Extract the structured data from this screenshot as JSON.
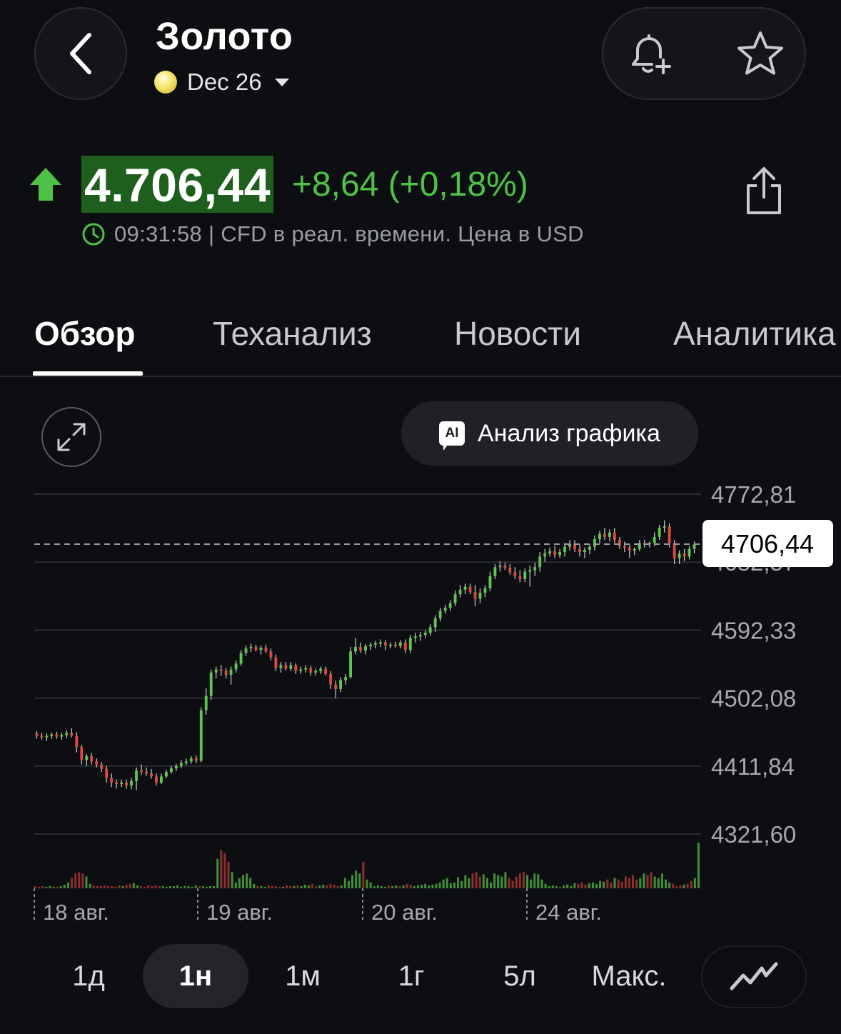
{
  "header": {
    "title": "Золото",
    "contract": "Dec 26",
    "back_icon": "chevron-left-icon",
    "alert_icon": "bell-plus-icon",
    "watchlist_icon": "star-icon",
    "share_icon": "share-icon"
  },
  "quote": {
    "price": "4.706,44",
    "change": "+8,64 (+0,18%)",
    "direction": "up",
    "meta": "09:31:58 | CFD в реал. времени. Цена в USD",
    "up_color": "#4ec246",
    "price_bg_color": "#1f5f1e"
  },
  "tabs": [
    {
      "label": "Обзор",
      "active": true
    },
    {
      "label": "Теханализ",
      "active": false
    },
    {
      "label": "Новости",
      "active": false
    },
    {
      "label": "Аналитика",
      "active": false
    }
  ],
  "chart_actions": {
    "expand_icon": "expand-icon",
    "ai_badge": "AI",
    "ai_label": "Анализ графика"
  },
  "chart_data": {
    "type": "candlestick",
    "y_ticks": [
      "4772,81",
      "4682,57",
      "4592,33",
      "4502,08",
      "4411,84",
      "4321,60"
    ],
    "y_tick_values": [
      4772.81,
      4682.57,
      4592.33,
      4502.08,
      4411.84,
      4321.6
    ],
    "ylim": [
      4321.6,
      4772.81
    ],
    "current_price_label": "4706,44",
    "current_price": 4706.44,
    "x_tick_labels": [
      "18 авг.",
      "19 авг.",
      "20 авг.",
      "24 авг."
    ],
    "grid": true,
    "up_color": "#5cc94e",
    "down_color": "#e0483f",
    "candles": [
      {
        "o": 4455,
        "h": 4458,
        "l": 4448,
        "c": 4452
      },
      {
        "o": 4452,
        "h": 4456,
        "l": 4447,
        "c": 4450
      },
      {
        "o": 4450,
        "h": 4455,
        "l": 4445,
        "c": 4452
      },
      {
        "o": 4452,
        "h": 4456,
        "l": 4448,
        "c": 4454
      },
      {
        "o": 4454,
        "h": 4457,
        "l": 4448,
        "c": 4451
      },
      {
        "o": 4451,
        "h": 4456,
        "l": 4447,
        "c": 4453
      },
      {
        "o": 4453,
        "h": 4459,
        "l": 4449,
        "c": 4456
      },
      {
        "o": 4456,
        "h": 4462,
        "l": 4450,
        "c": 4452
      },
      {
        "o": 4452,
        "h": 4457,
        "l": 4430,
        "c": 4437
      },
      {
        "o": 4437,
        "h": 4440,
        "l": 4414,
        "c": 4420
      },
      {
        "o": 4420,
        "h": 4428,
        "l": 4412,
        "c": 4425
      },
      {
        "o": 4425,
        "h": 4429,
        "l": 4414,
        "c": 4418
      },
      {
        "o": 4418,
        "h": 4422,
        "l": 4410,
        "c": 4414
      },
      {
        "o": 4414,
        "h": 4417,
        "l": 4404,
        "c": 4408
      },
      {
        "o": 4408,
        "h": 4412,
        "l": 4390,
        "c": 4396
      },
      {
        "o": 4396,
        "h": 4402,
        "l": 4384,
        "c": 4390
      },
      {
        "o": 4390,
        "h": 4394,
        "l": 4382,
        "c": 4388
      },
      {
        "o": 4388,
        "h": 4394,
        "l": 4384,
        "c": 4390
      },
      {
        "o": 4390,
        "h": 4394,
        "l": 4382,
        "c": 4386
      },
      {
        "o": 4386,
        "h": 4396,
        "l": 4381,
        "c": 4392
      },
      {
        "o": 4392,
        "h": 4410,
        "l": 4380,
        "c": 4406
      },
      {
        "o": 4406,
        "h": 4414,
        "l": 4400,
        "c": 4404
      },
      {
        "o": 4404,
        "h": 4410,
        "l": 4399,
        "c": 4402
      },
      {
        "o": 4402,
        "h": 4408,
        "l": 4395,
        "c": 4398
      },
      {
        "o": 4398,
        "h": 4402,
        "l": 4386,
        "c": 4390
      },
      {
        "o": 4390,
        "h": 4402,
        "l": 4388,
        "c": 4398
      },
      {
        "o": 4398,
        "h": 4407,
        "l": 4396,
        "c": 4404
      },
      {
        "o": 4404,
        "h": 4412,
        "l": 4402,
        "c": 4409
      },
      {
        "o": 4409,
        "h": 4415,
        "l": 4405,
        "c": 4412
      },
      {
        "o": 4412,
        "h": 4420,
        "l": 4409,
        "c": 4416
      },
      {
        "o": 4416,
        "h": 4422,
        "l": 4413,
        "c": 4418
      },
      {
        "o": 4418,
        "h": 4425,
        "l": 4415,
        "c": 4422
      },
      {
        "o": 4422,
        "h": 4426,
        "l": 4416,
        "c": 4419
      },
      {
        "o": 4419,
        "h": 4490,
        "l": 4417,
        "c": 4486
      },
      {
        "o": 4486,
        "h": 4515,
        "l": 4480,
        "c": 4505
      },
      {
        "o": 4505,
        "h": 4540,
        "l": 4500,
        "c": 4536
      },
      {
        "o": 4536,
        "h": 4544,
        "l": 4528,
        "c": 4540
      },
      {
        "o": 4540,
        "h": 4546,
        "l": 4532,
        "c": 4538
      },
      {
        "o": 4538,
        "h": 4542,
        "l": 4528,
        "c": 4533
      },
      {
        "o": 4533,
        "h": 4544,
        "l": 4520,
        "c": 4540
      },
      {
        "o": 4540,
        "h": 4552,
        "l": 4536,
        "c": 4548
      },
      {
        "o": 4548,
        "h": 4566,
        "l": 4545,
        "c": 4562
      },
      {
        "o": 4562,
        "h": 4572,
        "l": 4558,
        "c": 4568
      },
      {
        "o": 4568,
        "h": 4574,
        "l": 4563,
        "c": 4570
      },
      {
        "o": 4570,
        "h": 4573,
        "l": 4564,
        "c": 4566
      },
      {
        "o": 4566,
        "h": 4572,
        "l": 4560,
        "c": 4569
      },
      {
        "o": 4569,
        "h": 4573,
        "l": 4562,
        "c": 4564
      },
      {
        "o": 4564,
        "h": 4568,
        "l": 4552,
        "c": 4556
      },
      {
        "o": 4556,
        "h": 4560,
        "l": 4538,
        "c": 4542
      },
      {
        "o": 4542,
        "h": 4550,
        "l": 4536,
        "c": 4546
      },
      {
        "o": 4546,
        "h": 4550,
        "l": 4539,
        "c": 4541
      },
      {
        "o": 4541,
        "h": 4550,
        "l": 4538,
        "c": 4546
      },
      {
        "o": 4546,
        "h": 4548,
        "l": 4534,
        "c": 4538
      },
      {
        "o": 4538,
        "h": 4544,
        "l": 4534,
        "c": 4540
      },
      {
        "o": 4540,
        "h": 4546,
        "l": 4536,
        "c": 4542
      },
      {
        "o": 4542,
        "h": 4545,
        "l": 4532,
        "c": 4536
      },
      {
        "o": 4536,
        "h": 4541,
        "l": 4532,
        "c": 4538
      },
      {
        "o": 4538,
        "h": 4544,
        "l": 4534,
        "c": 4541
      },
      {
        "o": 4541,
        "h": 4544,
        "l": 4532,
        "c": 4534
      },
      {
        "o": 4534,
        "h": 4538,
        "l": 4514,
        "c": 4520
      },
      {
        "o": 4520,
        "h": 4525,
        "l": 4502,
        "c": 4514
      },
      {
        "o": 4514,
        "h": 4530,
        "l": 4510,
        "c": 4526
      },
      {
        "o": 4526,
        "h": 4534,
        "l": 4520,
        "c": 4530
      },
      {
        "o": 4530,
        "h": 4570,
        "l": 4528,
        "c": 4564
      },
      {
        "o": 4564,
        "h": 4582,
        "l": 4560,
        "c": 4570
      },
      {
        "o": 4570,
        "h": 4576,
        "l": 4562,
        "c": 4565
      },
      {
        "o": 4565,
        "h": 4574,
        "l": 4560,
        "c": 4571
      },
      {
        "o": 4571,
        "h": 4576,
        "l": 4566,
        "c": 4573
      },
      {
        "o": 4573,
        "h": 4578,
        "l": 4568,
        "c": 4575
      },
      {
        "o": 4575,
        "h": 4580,
        "l": 4570,
        "c": 4576
      },
      {
        "o": 4576,
        "h": 4579,
        "l": 4566,
        "c": 4572
      },
      {
        "o": 4572,
        "h": 4576,
        "l": 4568,
        "c": 4573
      },
      {
        "o": 4573,
        "h": 4577,
        "l": 4569,
        "c": 4571
      },
      {
        "o": 4571,
        "h": 4579,
        "l": 4568,
        "c": 4576
      },
      {
        "o": 4576,
        "h": 4580,
        "l": 4562,
        "c": 4566
      },
      {
        "o": 4566,
        "h": 4586,
        "l": 4562,
        "c": 4582
      },
      {
        "o": 4582,
        "h": 4589,
        "l": 4576,
        "c": 4584
      },
      {
        "o": 4584,
        "h": 4590,
        "l": 4578,
        "c": 4586
      },
      {
        "o": 4586,
        "h": 4592,
        "l": 4582,
        "c": 4589
      },
      {
        "o": 4589,
        "h": 4600,
        "l": 4585,
        "c": 4596
      },
      {
        "o": 4596,
        "h": 4612,
        "l": 4590,
        "c": 4608
      },
      {
        "o": 4608,
        "h": 4622,
        "l": 4604,
        "c": 4618
      },
      {
        "o": 4618,
        "h": 4626,
        "l": 4614,
        "c": 4622
      },
      {
        "o": 4622,
        "h": 4632,
        "l": 4618,
        "c": 4628
      },
      {
        "o": 4628,
        "h": 4645,
        "l": 4624,
        "c": 4640
      },
      {
        "o": 4640,
        "h": 4652,
        "l": 4636,
        "c": 4646
      },
      {
        "o": 4646,
        "h": 4654,
        "l": 4640,
        "c": 4650
      },
      {
        "o": 4650,
        "h": 4654,
        "l": 4640,
        "c": 4643
      },
      {
        "o": 4643,
        "h": 4652,
        "l": 4624,
        "c": 4634
      },
      {
        "o": 4634,
        "h": 4648,
        "l": 4628,
        "c": 4642
      },
      {
        "o": 4642,
        "h": 4652,
        "l": 4636,
        "c": 4648
      },
      {
        "o": 4648,
        "h": 4670,
        "l": 4644,
        "c": 4664
      },
      {
        "o": 4664,
        "h": 4680,
        "l": 4660,
        "c": 4676
      },
      {
        "o": 4676,
        "h": 4684,
        "l": 4670,
        "c": 4678
      },
      {
        "o": 4678,
        "h": 4682,
        "l": 4672,
        "c": 4675
      },
      {
        "o": 4675,
        "h": 4680,
        "l": 4666,
        "c": 4669
      },
      {
        "o": 4669,
        "h": 4676,
        "l": 4660,
        "c": 4664
      },
      {
        "o": 4664,
        "h": 4672,
        "l": 4656,
        "c": 4660
      },
      {
        "o": 4660,
        "h": 4674,
        "l": 4656,
        "c": 4670
      },
      {
        "o": 4670,
        "h": 4678,
        "l": 4650,
        "c": 4672
      },
      {
        "o": 4672,
        "h": 4682,
        "l": 4664,
        "c": 4676
      },
      {
        "o": 4676,
        "h": 4696,
        "l": 4670,
        "c": 4690
      },
      {
        "o": 4690,
        "h": 4700,
        "l": 4683,
        "c": 4694
      },
      {
        "o": 4694,
        "h": 4702,
        "l": 4690,
        "c": 4697
      },
      {
        "o": 4697,
        "h": 4704,
        "l": 4688,
        "c": 4692
      },
      {
        "o": 4692,
        "h": 4700,
        "l": 4688,
        "c": 4696
      },
      {
        "o": 4696,
        "h": 4708,
        "l": 4690,
        "c": 4703
      },
      {
        "o": 4703,
        "h": 4712,
        "l": 4698,
        "c": 4707
      },
      {
        "o": 4707,
        "h": 4712,
        "l": 4696,
        "c": 4700
      },
      {
        "o": 4700,
        "h": 4706,
        "l": 4690,
        "c": 4696
      },
      {
        "o": 4696,
        "h": 4702,
        "l": 4688,
        "c": 4699
      },
      {
        "o": 4699,
        "h": 4706,
        "l": 4693,
        "c": 4703
      },
      {
        "o": 4703,
        "h": 4718,
        "l": 4698,
        "c": 4713
      },
      {
        "o": 4713,
        "h": 4724,
        "l": 4708,
        "c": 4720
      },
      {
        "o": 4720,
        "h": 4728,
        "l": 4712,
        "c": 4716
      },
      {
        "o": 4716,
        "h": 4726,
        "l": 4710,
        "c": 4722
      },
      {
        "o": 4722,
        "h": 4728,
        "l": 4708,
        "c": 4712
      },
      {
        "o": 4712,
        "h": 4716,
        "l": 4700,
        "c": 4704
      },
      {
        "o": 4704,
        "h": 4710,
        "l": 4696,
        "c": 4702
      },
      {
        "o": 4702,
        "h": 4706,
        "l": 4688,
        "c": 4698
      },
      {
        "o": 4698,
        "h": 4702,
        "l": 4692,
        "c": 4700
      },
      {
        "o": 4700,
        "h": 4712,
        "l": 4697,
        "c": 4708
      },
      {
        "o": 4708,
        "h": 4712,
        "l": 4702,
        "c": 4706
      },
      {
        "o": 4706,
        "h": 4710,
        "l": 4702,
        "c": 4708
      },
      {
        "o": 4708,
        "h": 4722,
        "l": 4704,
        "c": 4716
      },
      {
        "o": 4716,
        "h": 4732,
        "l": 4712,
        "c": 4728
      },
      {
        "o": 4728,
        "h": 4738,
        "l": 4722,
        "c": 4730
      },
      {
        "o": 4730,
        "h": 4734,
        "l": 4702,
        "c": 4708
      },
      {
        "o": 4708,
        "h": 4712,
        "l": 4680,
        "c": 4688
      },
      {
        "o": 4688,
        "h": 4698,
        "l": 4680,
        "c": 4694
      },
      {
        "o": 4694,
        "h": 4700,
        "l": 4684,
        "c": 4690
      },
      {
        "o": 4690,
        "h": 4704,
        "l": 4686,
        "c": 4700
      },
      {
        "o": 4700,
        "h": 4710,
        "l": 4694,
        "c": 4706
      }
    ],
    "volumes": [
      3,
      2,
      3,
      2,
      3,
      2,
      2,
      3,
      5,
      8,
      14,
      20,
      22,
      20,
      16,
      6,
      4,
      3,
      3,
      4,
      3,
      3,
      2,
      4,
      3,
      5,
      6,
      7,
      4,
      3,
      2,
      4,
      3,
      4,
      3,
      3,
      2,
      3,
      3,
      4,
      2,
      3,
      3,
      2,
      4,
      3,
      3,
      2,
      3,
      3,
      40,
      52,
      48,
      36,
      22,
      8,
      14,
      18,
      20,
      14,
      6,
      3,
      3,
      2,
      4,
      3,
      3,
      2,
      2,
      4,
      3,
      3,
      4,
      3,
      5,
      4,
      6,
      3,
      4,
      5,
      4,
      6,
      5,
      3,
      4,
      14,
      10,
      18,
      24,
      20,
      36,
      12,
      8,
      3,
      4,
      3,
      2,
      4,
      3,
      4,
      3,
      4,
      6,
      5,
      3,
      4,
      5,
      6,
      4,
      5,
      6,
      8,
      12,
      14,
      7,
      8,
      15,
      10,
      18,
      14,
      20,
      22,
      16,
      19,
      14,
      8,
      20,
      18,
      16,
      22,
      14,
      10,
      16,
      20,
      22,
      18,
      12,
      20,
      19,
      12,
      6,
      3,
      4,
      3,
      2,
      4,
      5,
      3,
      7,
      6,
      8,
      5,
      7,
      8,
      6,
      10,
      9,
      12,
      8,
      14,
      12,
      9,
      16,
      14,
      18,
      12,
      14,
      20,
      18,
      22,
      16,
      14,
      20,
      12,
      8,
      6,
      3,
      4,
      5,
      6,
      10,
      14,
      62
    ],
    "volume_color": "#3f8f36",
    "volume_down_color": "#8b2e2e"
  },
  "periods": [
    {
      "label": "1д",
      "active": false
    },
    {
      "label": "1н",
      "active": true
    },
    {
      "label": "1м",
      "active": false
    },
    {
      "label": "1г",
      "active": false
    },
    {
      "label": "5л",
      "active": false
    },
    {
      "label": "Макс.",
      "active": false
    }
  ],
  "chart_type_icon": "line-chart-icon"
}
